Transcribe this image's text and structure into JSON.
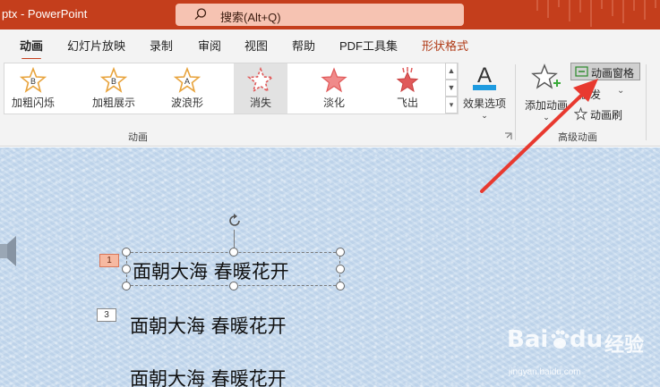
{
  "titlebar": {
    "doc_title": "ptx  -  PowerPoint",
    "search_placeholder": "搜索(Alt+Q)"
  },
  "tabs": [
    {
      "label": "动画",
      "active": true
    },
    {
      "label": "幻灯片放映"
    },
    {
      "label": "录制"
    },
    {
      "label": "审阅"
    },
    {
      "label": "视图"
    },
    {
      "label": "帮助"
    },
    {
      "label": "PDF工具集"
    },
    {
      "label": "形状格式",
      "contextual": true
    }
  ],
  "gallery": {
    "effects": [
      {
        "label": "加粗闪烁",
        "icon": "bold-flash-star-icon",
        "color": "#e8a33c"
      },
      {
        "label": "加粗展示",
        "icon": "bold-reveal-star-icon",
        "color": "#e8a33c"
      },
      {
        "label": "波浪形",
        "icon": "wave-star-icon",
        "color": "#e8a33c"
      },
      {
        "label": "消失",
        "icon": "disappear-star-icon",
        "color": "#e05a5a",
        "selected": true
      },
      {
        "label": "淡化",
        "icon": "fade-star-icon",
        "color": "#e05a5a"
      },
      {
        "label": "飞出",
        "icon": "fly-out-star-icon",
        "color": "#e05a5a"
      }
    ]
  },
  "effect_options": {
    "label": "效果选项"
  },
  "group_animation": {
    "label": "动画"
  },
  "add_animation": {
    "label": "添加动画"
  },
  "advanced": {
    "animation_pane": "动画窗格",
    "trigger": "触发",
    "painter": "动画刷",
    "group_label": "高级动画"
  },
  "slide": {
    "lines": [
      "面朝大海 春暖花开",
      "面朝大海  春暖花开",
      "面朝大海  春暖花开"
    ],
    "tags": [
      "1",
      "3"
    ]
  },
  "watermark": {
    "brand": "Bai",
    "brand2": "du",
    "suffix": "经验",
    "url": "jingyan.baidu.com"
  },
  "colors": {
    "accent": "#c43e1c",
    "arrow": "#e8392f"
  }
}
